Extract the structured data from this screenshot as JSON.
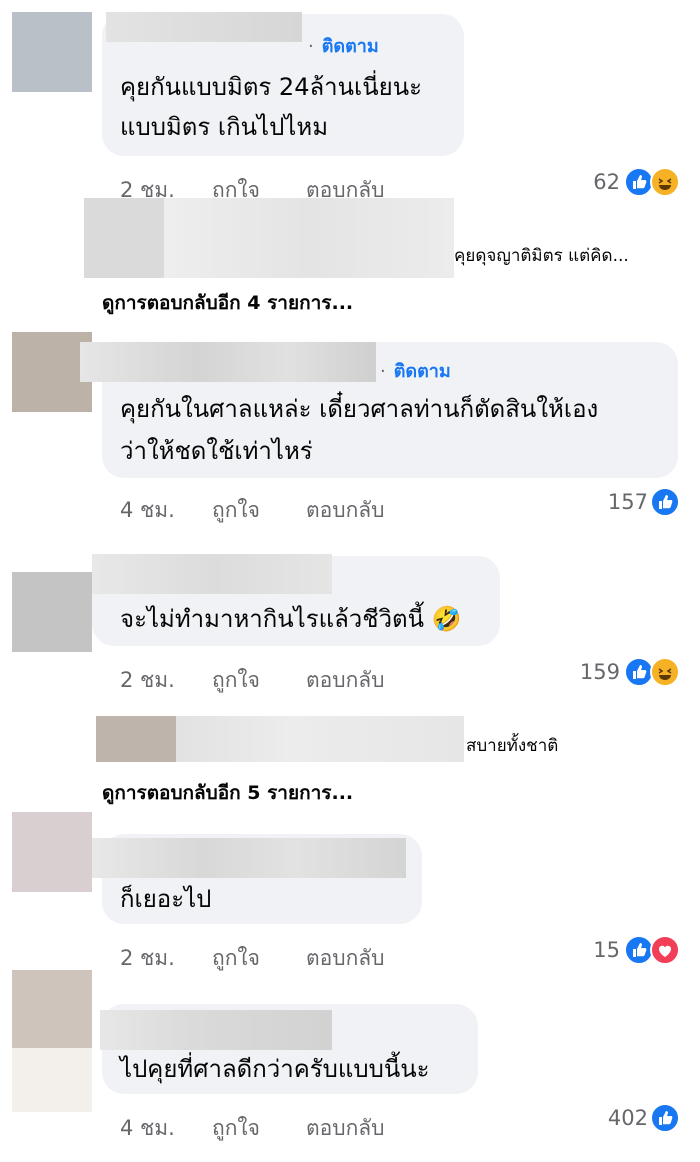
{
  "actions": {
    "like": "ถูกใจ",
    "reply": "ตอบกลับ"
  },
  "follow_label": "ติดตาม",
  "follow_dot": "·",
  "comments": [
    {
      "text_lines": [
        "คุยกันแบบมิตร 24ล้านเนี่ยนะ",
        "แบบมิตร เกินไปไหม"
      ],
      "time": "2 ชม.",
      "reactions_count": "62",
      "reactions": [
        "like-icon",
        "haha-icon"
      ],
      "follow": true
    },
    {
      "text_lines": [
        "คุยกันในศาลแหล่ะ เดี๋ยวศาลท่านก็ตัดสินให้เอง",
        "ว่าให้ชดใช้เท่าไหร่"
      ],
      "time": "4 ชม.",
      "reactions_count": "157",
      "reactions": [
        "like-icon"
      ],
      "follow": true
    },
    {
      "text_lines": [
        "จะไม่ทำมาหากินไรแล้วชีวิตนี้ 🤣"
      ],
      "time": "2 ชม.",
      "reactions_count": "159",
      "reactions": [
        "like-icon",
        "haha-icon"
      ],
      "follow": false
    },
    {
      "text_lines": [
        "ก็เยอะไป"
      ],
      "time": "2 ชม.",
      "reactions_count": "15",
      "reactions": [
        "like-icon",
        "love-icon"
      ],
      "follow": false
    },
    {
      "text_lines": [
        "ไปคุยที่ศาลดีกว่าครับแบบนี้นะ"
      ],
      "time": "4 ชม.",
      "reactions_count": "402",
      "reactions": [
        "like-icon"
      ],
      "follow": false
    }
  ],
  "reply_previews": [
    {
      "snippet": "คุยดุจญาติมิตร แต่คิด...",
      "more_label": "ดูการตอบกลับอีก 4 รายการ..."
    },
    {
      "snippet": "สบายทั้งชาติ",
      "more_label": "ดูการตอบกลับอีก 5 รายการ..."
    }
  ],
  "colors": {
    "link": "#1877f2",
    "meta": "#65676b",
    "bubble": "#f0f2f5",
    "like": "#1877f2",
    "haha": "#f7b125",
    "love": "#f33e58"
  }
}
